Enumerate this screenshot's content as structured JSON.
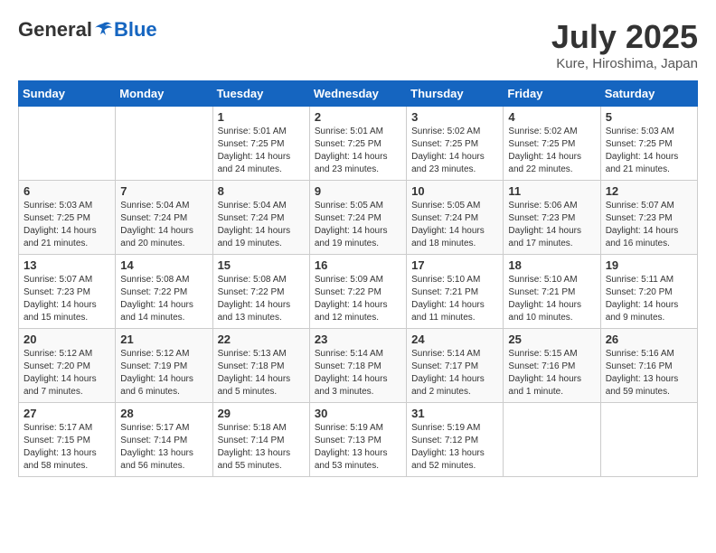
{
  "header": {
    "logo_general": "General",
    "logo_blue": "Blue",
    "month_title": "July 2025",
    "location": "Kure, Hiroshima, Japan"
  },
  "days_of_week": [
    "Sunday",
    "Monday",
    "Tuesday",
    "Wednesday",
    "Thursday",
    "Friday",
    "Saturday"
  ],
  "weeks": [
    [
      {
        "day": "",
        "content": ""
      },
      {
        "day": "",
        "content": ""
      },
      {
        "day": "1",
        "content": "Sunrise: 5:01 AM\nSunset: 7:25 PM\nDaylight: 14 hours and 24 minutes."
      },
      {
        "day": "2",
        "content": "Sunrise: 5:01 AM\nSunset: 7:25 PM\nDaylight: 14 hours and 23 minutes."
      },
      {
        "day": "3",
        "content": "Sunrise: 5:02 AM\nSunset: 7:25 PM\nDaylight: 14 hours and 23 minutes."
      },
      {
        "day": "4",
        "content": "Sunrise: 5:02 AM\nSunset: 7:25 PM\nDaylight: 14 hours and 22 minutes."
      },
      {
        "day": "5",
        "content": "Sunrise: 5:03 AM\nSunset: 7:25 PM\nDaylight: 14 hours and 21 minutes."
      }
    ],
    [
      {
        "day": "6",
        "content": "Sunrise: 5:03 AM\nSunset: 7:25 PM\nDaylight: 14 hours and 21 minutes."
      },
      {
        "day": "7",
        "content": "Sunrise: 5:04 AM\nSunset: 7:24 PM\nDaylight: 14 hours and 20 minutes."
      },
      {
        "day": "8",
        "content": "Sunrise: 5:04 AM\nSunset: 7:24 PM\nDaylight: 14 hours and 19 minutes."
      },
      {
        "day": "9",
        "content": "Sunrise: 5:05 AM\nSunset: 7:24 PM\nDaylight: 14 hours and 19 minutes."
      },
      {
        "day": "10",
        "content": "Sunrise: 5:05 AM\nSunset: 7:24 PM\nDaylight: 14 hours and 18 minutes."
      },
      {
        "day": "11",
        "content": "Sunrise: 5:06 AM\nSunset: 7:23 PM\nDaylight: 14 hours and 17 minutes."
      },
      {
        "day": "12",
        "content": "Sunrise: 5:07 AM\nSunset: 7:23 PM\nDaylight: 14 hours and 16 minutes."
      }
    ],
    [
      {
        "day": "13",
        "content": "Sunrise: 5:07 AM\nSunset: 7:23 PM\nDaylight: 14 hours and 15 minutes."
      },
      {
        "day": "14",
        "content": "Sunrise: 5:08 AM\nSunset: 7:22 PM\nDaylight: 14 hours and 14 minutes."
      },
      {
        "day": "15",
        "content": "Sunrise: 5:08 AM\nSunset: 7:22 PM\nDaylight: 14 hours and 13 minutes."
      },
      {
        "day": "16",
        "content": "Sunrise: 5:09 AM\nSunset: 7:22 PM\nDaylight: 14 hours and 12 minutes."
      },
      {
        "day": "17",
        "content": "Sunrise: 5:10 AM\nSunset: 7:21 PM\nDaylight: 14 hours and 11 minutes."
      },
      {
        "day": "18",
        "content": "Sunrise: 5:10 AM\nSunset: 7:21 PM\nDaylight: 14 hours and 10 minutes."
      },
      {
        "day": "19",
        "content": "Sunrise: 5:11 AM\nSunset: 7:20 PM\nDaylight: 14 hours and 9 minutes."
      }
    ],
    [
      {
        "day": "20",
        "content": "Sunrise: 5:12 AM\nSunset: 7:20 PM\nDaylight: 14 hours and 7 minutes."
      },
      {
        "day": "21",
        "content": "Sunrise: 5:12 AM\nSunset: 7:19 PM\nDaylight: 14 hours and 6 minutes."
      },
      {
        "day": "22",
        "content": "Sunrise: 5:13 AM\nSunset: 7:18 PM\nDaylight: 14 hours and 5 minutes."
      },
      {
        "day": "23",
        "content": "Sunrise: 5:14 AM\nSunset: 7:18 PM\nDaylight: 14 hours and 3 minutes."
      },
      {
        "day": "24",
        "content": "Sunrise: 5:14 AM\nSunset: 7:17 PM\nDaylight: 14 hours and 2 minutes."
      },
      {
        "day": "25",
        "content": "Sunrise: 5:15 AM\nSunset: 7:16 PM\nDaylight: 14 hours and 1 minute."
      },
      {
        "day": "26",
        "content": "Sunrise: 5:16 AM\nSunset: 7:16 PM\nDaylight: 13 hours and 59 minutes."
      }
    ],
    [
      {
        "day": "27",
        "content": "Sunrise: 5:17 AM\nSunset: 7:15 PM\nDaylight: 13 hours and 58 minutes."
      },
      {
        "day": "28",
        "content": "Sunrise: 5:17 AM\nSunset: 7:14 PM\nDaylight: 13 hours and 56 minutes."
      },
      {
        "day": "29",
        "content": "Sunrise: 5:18 AM\nSunset: 7:14 PM\nDaylight: 13 hours and 55 minutes."
      },
      {
        "day": "30",
        "content": "Sunrise: 5:19 AM\nSunset: 7:13 PM\nDaylight: 13 hours and 53 minutes."
      },
      {
        "day": "31",
        "content": "Sunrise: 5:19 AM\nSunset: 7:12 PM\nDaylight: 13 hours and 52 minutes."
      },
      {
        "day": "",
        "content": ""
      },
      {
        "day": "",
        "content": ""
      }
    ]
  ]
}
